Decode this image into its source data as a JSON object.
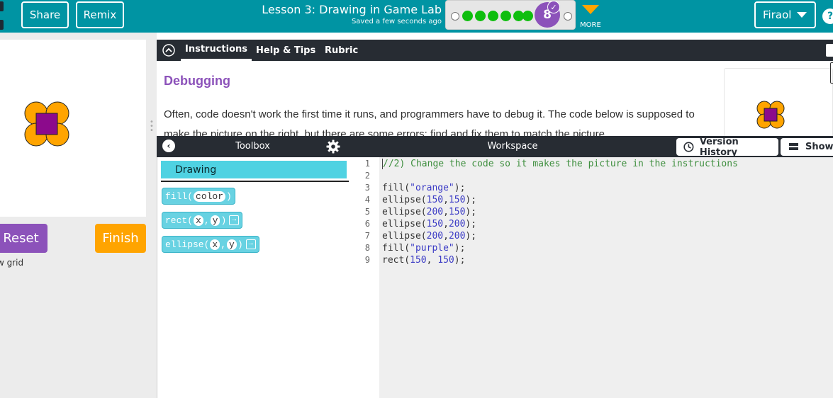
{
  "header": {
    "share_label": "Share",
    "remix_label": "Remix",
    "lesson_title": "Lesson 3: Drawing in Game Lab",
    "saved_text": "Saved a few seconds ago",
    "progress": {
      "current_level": "8",
      "completed_before": 7,
      "remaining_after": 1
    },
    "more_label": "MORE",
    "user_label": "Firaol",
    "help_label": "?",
    "accent_color": "#0094a3"
  },
  "left": {
    "reset_label": "Reset",
    "finish_label": "Finish",
    "grid_text": "w grid"
  },
  "instructions": {
    "tabs": [
      "Instructions",
      "Help & Tips",
      "Rubric"
    ],
    "heading": "Debugging",
    "text": "Often, code doesn't work the first time it runs, and programmers have to debug it. The code below is supposed to make the picture on the right, but there are some errors; find and fix them to match the picture."
  },
  "toolbox": {
    "title": "Toolbox",
    "category": "Drawing",
    "blocks": [
      {
        "fn": "fill",
        "params": [
          "color"
        ],
        "end": false
      },
      {
        "fn": "rect",
        "params": [
          "x",
          "y"
        ],
        "end": true
      },
      {
        "fn": "ellipse",
        "params": [
          "x",
          "y"
        ],
        "end": true
      }
    ]
  },
  "workspace": {
    "title": "Workspace",
    "version_history_label": "Version History",
    "show_label": "Show",
    "code": [
      {
        "n": "1",
        "tokens": [
          [
            "cm",
            "//2) Change the code so it makes the picture in the instructions"
          ]
        ]
      },
      {
        "n": "2",
        "tokens": []
      },
      {
        "n": "3",
        "tokens": [
          [
            "fn",
            "fill("
          ],
          [
            "str",
            "\"orange\""
          ],
          [
            "fn",
            ");"
          ]
        ]
      },
      {
        "n": "4",
        "tokens": [
          [
            "fn",
            "ellipse("
          ],
          [
            "num",
            "150"
          ],
          [
            "fn",
            ","
          ],
          [
            "num",
            "150"
          ],
          [
            "fn",
            ");"
          ]
        ]
      },
      {
        "n": "5",
        "tokens": [
          [
            "fn",
            "ellipse("
          ],
          [
            "num",
            "200"
          ],
          [
            "fn",
            ","
          ],
          [
            "num",
            "150"
          ],
          [
            "fn",
            ");"
          ]
        ]
      },
      {
        "n": "6",
        "tokens": [
          [
            "fn",
            "ellipse("
          ],
          [
            "num",
            "150"
          ],
          [
            "fn",
            ","
          ],
          [
            "num",
            "200"
          ],
          [
            "fn",
            ");"
          ]
        ]
      },
      {
        "n": "7",
        "tokens": [
          [
            "fn",
            "ellipse("
          ],
          [
            "num",
            "200"
          ],
          [
            "fn",
            ","
          ],
          [
            "num",
            "200"
          ],
          [
            "fn",
            ");"
          ]
        ]
      },
      {
        "n": "8",
        "tokens": [
          [
            "fn",
            "fill("
          ],
          [
            "str",
            "\"purple\""
          ],
          [
            "fn",
            ");"
          ]
        ]
      },
      {
        "n": "9",
        "tokens": [
          [
            "fn",
            "rect("
          ],
          [
            "num",
            "150"
          ],
          [
            "fn",
            ", "
          ],
          [
            "num",
            "150"
          ],
          [
            "fn",
            ");"
          ]
        ]
      }
    ]
  },
  "colors": {
    "orange": "#ffa400",
    "purple": "#8c0a8c",
    "brand_purple": "#8c52ba",
    "dark_bar": "#272c33"
  }
}
